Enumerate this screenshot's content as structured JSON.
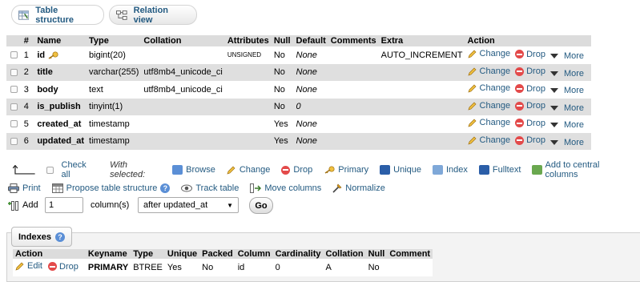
{
  "tabs": [
    {
      "label": "Table structure",
      "icon": "table-structure-icon",
      "active": true
    },
    {
      "label": "Relation view",
      "icon": "relation-view-icon",
      "active": false
    }
  ],
  "structure": {
    "headers": [
      "#",
      "Name",
      "Type",
      "Collation",
      "Attributes",
      "Null",
      "Default",
      "Comments",
      "Extra",
      "Action"
    ],
    "rows": [
      {
        "num": "1",
        "name": "id",
        "key_icon": "primary-key-icon",
        "type": "bigint(20)",
        "collation": "",
        "attributes": "UNSIGNED",
        "null": "No",
        "default": "None",
        "comments": "",
        "extra": "AUTO_INCREMENT"
      },
      {
        "num": "2",
        "name": "title",
        "type": "varchar(255)",
        "collation": "utf8mb4_unicode_ci",
        "attributes": "",
        "null": "No",
        "default": "None",
        "comments": "",
        "extra": ""
      },
      {
        "num": "3",
        "name": "body",
        "type": "text",
        "collation": "utf8mb4_unicode_ci",
        "attributes": "",
        "null": "No",
        "default": "None",
        "comments": "",
        "extra": ""
      },
      {
        "num": "4",
        "name": "is_publish",
        "type": "tinyint(1)",
        "collation": "",
        "attributes": "",
        "null": "No",
        "default": "0",
        "comments": "",
        "extra": ""
      },
      {
        "num": "5",
        "name": "created_at",
        "type": "timestamp",
        "collation": "",
        "attributes": "",
        "null": "Yes",
        "default": "None",
        "comments": "",
        "extra": ""
      },
      {
        "num": "6",
        "name": "updated_at",
        "type": "timestamp",
        "collation": "",
        "attributes": "",
        "null": "Yes",
        "default": "None",
        "comments": "",
        "extra": ""
      }
    ],
    "actions": {
      "change": "Change",
      "drop": "Drop",
      "more": "More"
    }
  },
  "bulk": {
    "check_all": "Check all",
    "with_selected": "With selected:",
    "items": [
      {
        "label": "Browse",
        "icon": "browse-icon",
        "color": "#5b8fd6"
      },
      {
        "label": "Change",
        "icon": "pencil-icon",
        "color": "#e0a020"
      },
      {
        "label": "Drop",
        "icon": "drop-icon",
        "color": "#e34a4a"
      },
      {
        "label": "Primary",
        "icon": "primary-key-icon",
        "color": "#e0b020"
      },
      {
        "label": "Unique",
        "icon": "unique-icon",
        "color": "#2b5ea8"
      },
      {
        "label": "Index",
        "icon": "index-icon",
        "color": "#7fa8d8"
      },
      {
        "label": "Fulltext",
        "icon": "fulltext-icon",
        "color": "#2b5ea8"
      },
      {
        "label": "Add to central columns",
        "icon": "central-columns-icon",
        "color": "#6aa84f"
      }
    ]
  },
  "tools": {
    "items": [
      {
        "label": "Print",
        "icon": "print-icon"
      },
      {
        "label": "Propose table structure",
        "icon": "propose-structure-icon"
      },
      {
        "label": "Track table",
        "icon": "track-table-icon"
      },
      {
        "label": "Move columns",
        "icon": "move-columns-icon"
      },
      {
        "label": "Normalize",
        "icon": "normalize-icon"
      }
    ]
  },
  "add": {
    "label": "Add",
    "count": "1",
    "unit": "column(s)",
    "position": "after updated_at",
    "go": "Go"
  },
  "indexes": {
    "legend": "Indexes",
    "headers": [
      "Action",
      "Keyname",
      "Type",
      "Unique",
      "Packed",
      "Column",
      "Cardinality",
      "Collation",
      "Null",
      "Comment"
    ],
    "rows": [
      {
        "edit": "Edit",
        "drop": "Drop",
        "keyname": "PRIMARY",
        "type": "BTREE",
        "unique": "Yes",
        "packed": "No",
        "column": "id",
        "cardinality": "0",
        "collation": "A",
        "null": "No",
        "comment": ""
      }
    ]
  }
}
